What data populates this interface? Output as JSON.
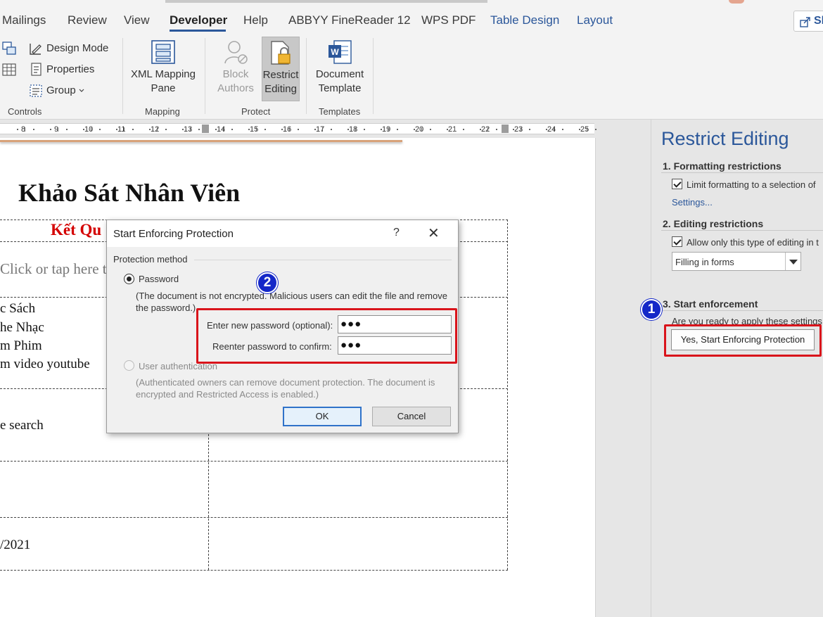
{
  "ribbon": {
    "tabs": [
      {
        "label": "Mailings"
      },
      {
        "label": "Review"
      },
      {
        "label": "View"
      },
      {
        "label": "Developer"
      },
      {
        "label": "Help"
      },
      {
        "label": "ABBYY FineReader 12"
      },
      {
        "label": "WPS PDF"
      },
      {
        "label": "Table Design"
      },
      {
        "label": "Layout"
      }
    ],
    "active_tab": "Developer",
    "share_label": "Sh",
    "controls": {
      "design_mode": "Design Mode",
      "properties": "Properties",
      "group": "Group",
      "group_label": "Controls"
    },
    "mapping": {
      "xml_line1": "XML Mapping",
      "xml_line2": "Pane",
      "group_label": "Mapping"
    },
    "protect": {
      "block_line1": "Block",
      "block_line2": "Authors",
      "restrict_line1": "Restrict",
      "restrict_line2": "Editing",
      "group_label": "Protect"
    },
    "templates": {
      "doc_line1": "Document",
      "doc_line2": "Template",
      "group_label": "Templates"
    }
  },
  "ruler": {
    "numbers": [
      "8",
      "9",
      "10",
      "11",
      "12",
      "13",
      "14",
      "15",
      "16",
      "17",
      "18",
      "19",
      "20",
      "21",
      "22",
      "23",
      "24",
      "25"
    ]
  },
  "document": {
    "title": "Khảo Sát Nhân Viên",
    "result_heading": "Kết Qu",
    "placeholder": "Click or tap here to",
    "items": [
      "c Sách",
      "he Nhạc",
      "m Phim",
      "m video youtube"
    ],
    "search_text": "e search",
    "date_text": "/2021"
  },
  "dialog": {
    "title": "Start Enforcing Protection",
    "help": "?",
    "close": "✕",
    "section": "Protection method",
    "password_label": "Password",
    "password_note_1": "(The document is not encrypted. Malicious users can edit the file and remove",
    "password_note_2": "the password.)",
    "new_password_label": "Enter new password (optional):",
    "new_password_value": "●●●",
    "reenter_label": "Reenter password to confirm:",
    "reenter_value": "●●●",
    "user_auth_label": "User authentication",
    "user_auth_note_1": "(Authenticated owners can remove document protection. The document is",
    "user_auth_note_2": "encrypted and Restricted Access is enabled.)",
    "ok": "OK",
    "cancel": "Cancel"
  },
  "pane": {
    "title": "Restrict Editing",
    "section1": "1. Formatting restrictions",
    "limit_formatting": "Limit formatting to a selection of",
    "settings_link": "Settings...",
    "section2": "2. Editing restrictions",
    "allow_only": "Allow only this type of editing in t",
    "editing_type": "Filling in forms",
    "section3": "3. Start enforcement",
    "ready_text": "Are you ready to apply these settings",
    "enforce_button": "Yes, Start Enforcing Protection"
  },
  "annotations": {
    "badge1": "1",
    "badge2": "2",
    "highlight_color": "#d9141b",
    "badge_color": "#1428c8"
  },
  "colors": {
    "accent_blue": "#2b579a",
    "heading_red": "#d40000"
  }
}
